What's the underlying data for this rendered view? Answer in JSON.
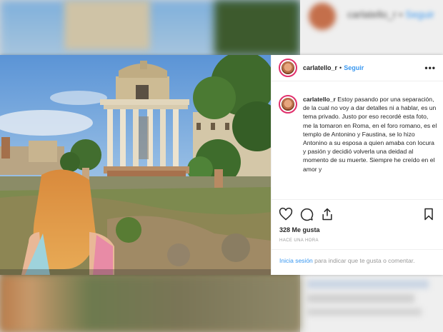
{
  "post": {
    "username": "carlatello_r",
    "separator": "•",
    "follow_label": "Seguir",
    "more_label": "•••",
    "caption_text": " Estoy pasando por una separación, de la cual no voy a dar detalles ni a hablar, es un tema privado. Justo por eso recordé esta foto, me la tomaron en Roma, en el foro romano, es el templo de Antonino y Faustina, se lo hizo Antonino a su esposa a quien amaba con locura y pasión y decidió volverla una deidad al momento de su muerte. Siempre he creído en el amor y",
    "likes": "328 Me gusta",
    "time_ago": "HACE UNA HORA",
    "login_link": "Inicia sesión",
    "login_text": " para indicar que te gusta o comentar."
  },
  "background": {
    "blurred_username": "carlatello_r",
    "blurred_follow": "Seguir"
  },
  "colors": {
    "link_blue": "#3897f0",
    "text_dark": "#262626",
    "text_muted": "#999999",
    "avatar_ring": "#e1306c"
  },
  "icons": [
    "heart-icon",
    "comment-icon",
    "share-icon",
    "bookmark-icon"
  ]
}
